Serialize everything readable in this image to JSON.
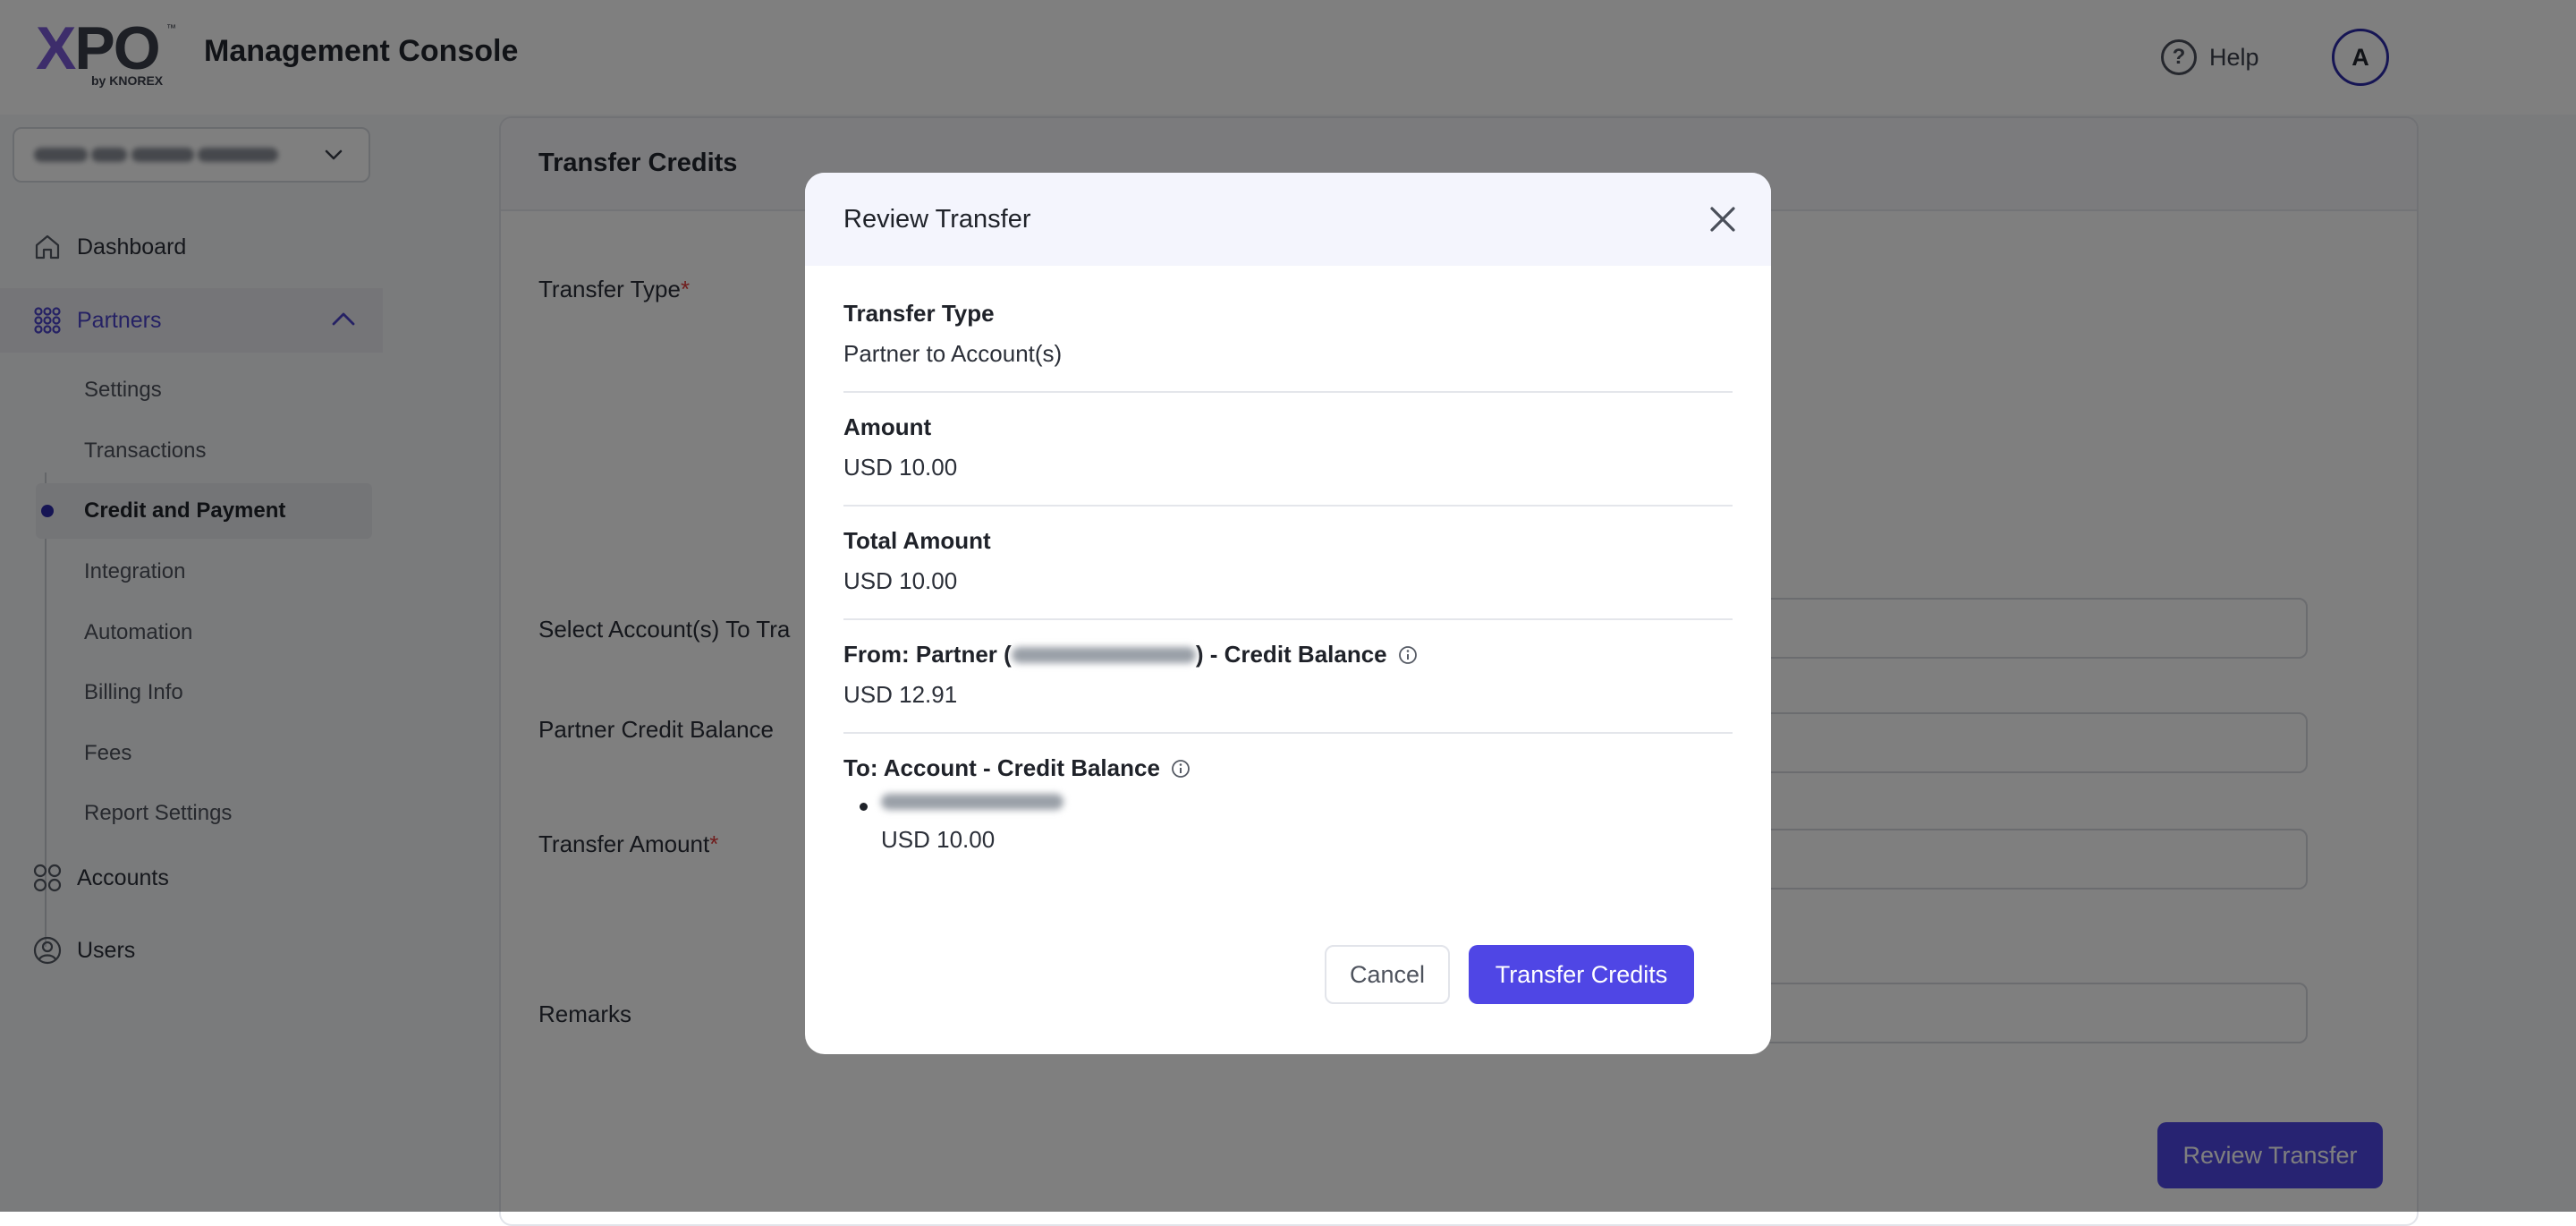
{
  "app": {
    "logo_text_x": "X",
    "logo_text_po": "PO",
    "logo_tm": "™",
    "logo_sub": "by KNOREX",
    "title": "Management Console"
  },
  "header": {
    "help_label": "Help",
    "help_icon": "question-circle-icon",
    "avatar_initial": "A"
  },
  "sidebar": {
    "account_selector": {
      "value_visible": false,
      "icon": "chevron-down-icon"
    },
    "items": [
      {
        "label": "Dashboard",
        "icon": "home-icon"
      },
      {
        "label": "Partners",
        "icon": "grid-dots-icon",
        "expanded": true
      },
      {
        "label": "Accounts",
        "icon": "four-circles-icon"
      },
      {
        "label": "Users",
        "icon": "user-circle-icon"
      }
    ],
    "partners_sub": [
      {
        "label": "Settings"
      },
      {
        "label": "Transactions"
      },
      {
        "label": "Credit and Payment",
        "current": true
      },
      {
        "label": "Integration"
      },
      {
        "label": "Automation"
      },
      {
        "label": "Billing Info"
      },
      {
        "label": "Fees"
      },
      {
        "label": "Report Settings"
      }
    ]
  },
  "page": {
    "card_title": "Transfer Credits",
    "labels": {
      "transfer_type": "Transfer Type",
      "select_accounts": "Select Account(s) To Tra",
      "partner_credit_balance": "Partner Credit Balance",
      "transfer_amount": "Transfer Amount",
      "remarks": "Remarks"
    },
    "required_mark": "*",
    "review_button": "Review Transfer"
  },
  "modal": {
    "title": "Review Transfer",
    "close_icon": "close-icon",
    "transfer_type_label": "Transfer Type",
    "transfer_type_value": "Partner to Account(s)",
    "amount_label": "Amount",
    "amount_value": "USD 10.00",
    "total_label": "Total Amount",
    "total_value": "USD 10.00",
    "from_prefix": "From: Partner (",
    "from_suffix": ") - Credit Balance",
    "from_value": "USD 12.91",
    "to_label": "To: Account - Credit Balance",
    "to_items": [
      {
        "amount": "USD 10.00"
      }
    ],
    "info_icon": "info-circle-icon",
    "cancel_label": "Cancel",
    "confirm_label": "Transfer Credits"
  },
  "colors": {
    "accent": "#4f46e5",
    "nav_active": "#4a43c9",
    "required": "#e03b3b",
    "overlay": "rgba(0,0,0,0.5)"
  }
}
